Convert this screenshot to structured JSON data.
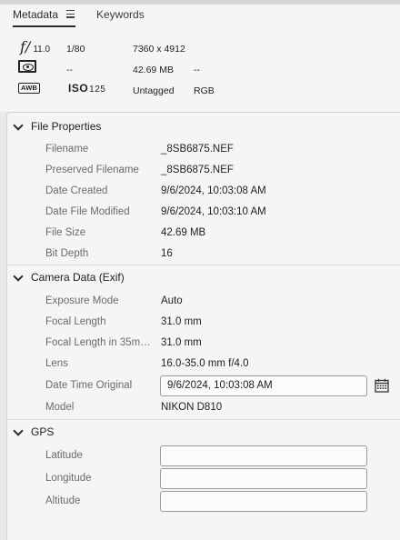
{
  "tabs": {
    "metadata": "Metadata",
    "keywords": "Keywords"
  },
  "quick": {
    "aperture_symbol": "f/",
    "aperture_value": "11.0",
    "shutter": "1/80",
    "dimensions": "7360 x 4912",
    "metering_value": "--",
    "file_size": "42.69 MB",
    "size_extra": "--",
    "white_balance_badge": "AWB",
    "iso_label": "ISO",
    "iso_value": "125",
    "color_label": "Untagged",
    "color_mode": "RGB",
    "icons": [
      "aperture-icon",
      "metering-icon",
      "white-balance-icon"
    ]
  },
  "file_properties": {
    "title": "File Properties",
    "rows": [
      {
        "label": "Filename",
        "value": "_8SB6875.NEF"
      },
      {
        "label": "Preserved Filename",
        "value": "_8SB6875.NEF"
      },
      {
        "label": "Date Created",
        "value": "9/6/2024, 10:03:08 AM"
      },
      {
        "label": "Date File Modified",
        "value": "9/6/2024, 10:03:10 AM"
      },
      {
        "label": "File Size",
        "value": "42.69 MB"
      },
      {
        "label": "Bit Depth",
        "value": "16"
      }
    ]
  },
  "camera_data": {
    "title": "Camera Data (Exif)",
    "rows": [
      {
        "label": "Exposure Mode",
        "value": "Auto"
      },
      {
        "label": "Focal Length",
        "value": "31.0 mm"
      },
      {
        "label": "Focal Length in 35mm...",
        "value": "31.0 mm"
      },
      {
        "label": "Lens",
        "value": "16.0-35.0 mm f/4.0"
      },
      {
        "label": "Date Time Original",
        "value": "9/6/2024, 10:03:08 AM"
      },
      {
        "label": "Model",
        "value": "NIKON D810"
      }
    ]
  },
  "gps": {
    "title": "GPS",
    "rows": [
      {
        "label": "Latitude",
        "value": ""
      },
      {
        "label": "Longitude",
        "value": ""
      },
      {
        "label": "Altitude",
        "value": ""
      }
    ]
  }
}
